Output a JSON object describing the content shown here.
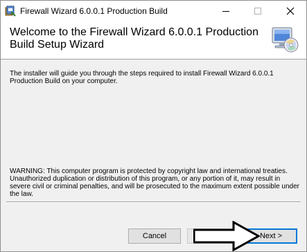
{
  "window": {
    "title": "Firewall Wizard 6.0.0.1 Production Build",
    "controls": [
      "minimize",
      "maximize",
      "close"
    ]
  },
  "header": {
    "title": "Welcome to the Firewall Wizard 6.0.0.1 Production Build Setup Wizard",
    "icon": "setup-computer-cd-icon"
  },
  "body": {
    "intro": "The installer will guide you through the steps required to install Firewall Wizard 6.0.0.1 Production Build on your computer.",
    "warning": "WARNING: This computer program is protected by copyright law and international treaties. Unauthorized duplication or distribution of this program, or any portion of it, may result in severe civil or criminal penalties, and will be prosecuted to the maximum extent possible under the law."
  },
  "buttons": {
    "cancel": "Cancel",
    "previous": "",
    "next": "Next >"
  },
  "colors": {
    "focus_border": "#0078d7",
    "annotation_arrow": "#000000"
  }
}
